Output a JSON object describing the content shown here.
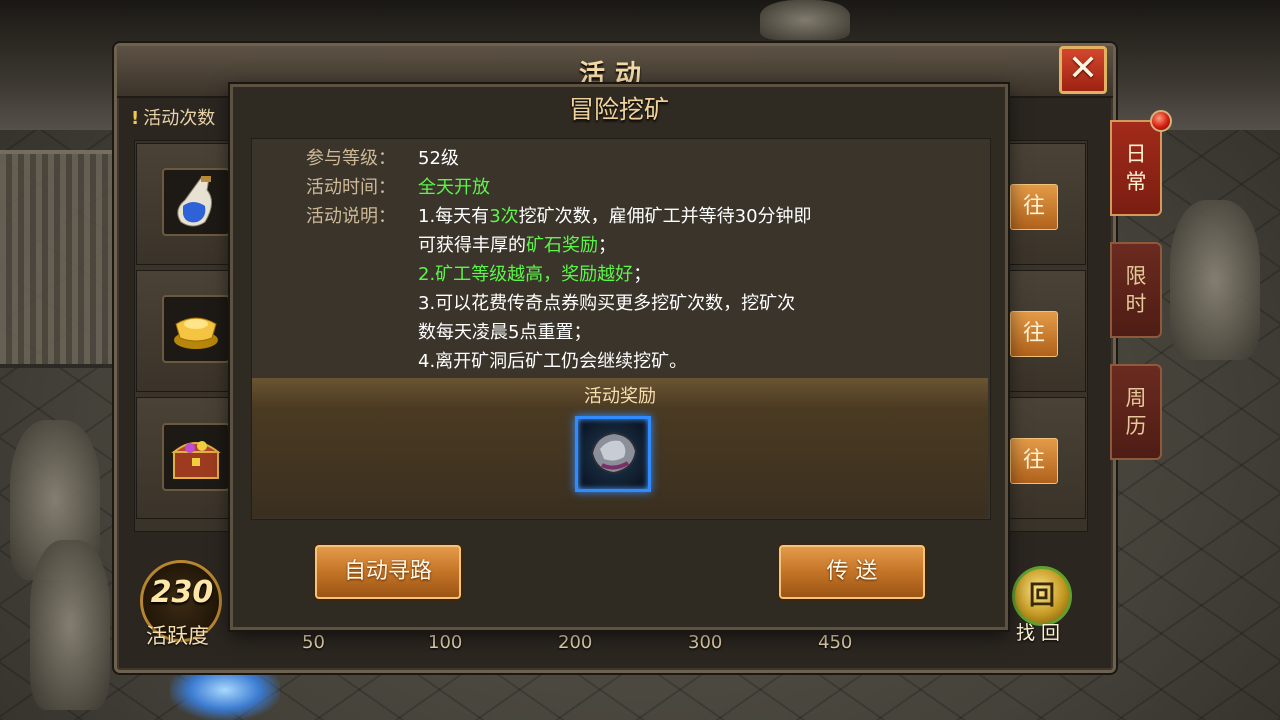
{
  "window": {
    "title": "活动",
    "close_icon": "close-icon",
    "count_label": "活动次数"
  },
  "list": {
    "rows": [
      {
        "icon": "potion-bottle-icon",
        "action_label": "往"
      },
      {
        "icon": "gold-ingot-icon",
        "action_label": "往"
      },
      {
        "icon": "treasure-chest-icon",
        "action_label": "往"
      }
    ]
  },
  "tabs": [
    {
      "label_line1": "日",
      "label_line2": "常",
      "active": true
    },
    {
      "label_line1": "限",
      "label_line2": "时",
      "active": false
    },
    {
      "label_line1": "周",
      "label_line2": "历",
      "active": false
    }
  ],
  "activity": {
    "points": "230",
    "label": "活跃度",
    "milestones": [
      "50",
      "100",
      "200",
      "300",
      "450"
    ],
    "return_icon_glyph": "回",
    "return_label": "找回"
  },
  "dialog": {
    "title": "冒险挖矿",
    "level_key": "参与等级：",
    "level_value": "52级",
    "time_key": "活动时间：",
    "time_value": "全天开放",
    "desc_key": "活动说明：",
    "desc": {
      "l1_a": "1.每天有",
      "l1_b": "3次",
      "l1_c": "挖矿次数，雇佣矿工并等待30分钟即",
      "l2_a": "可获得丰厚的",
      "l2_b": "矿石奖励",
      "l2_c": "；",
      "l3_a": "2.矿工",
      "l3_b": "等级越高，奖励越好",
      "l3_c": "；",
      "l4": "3.可以花费传奇点券购买更多挖矿次数，挖矿次",
      "l5": "数每天凌晨5点重置；",
      "l6": "4.离开矿洞后矿工仍会继续挖矿。"
    },
    "reward_title": "活动奖励",
    "reward_item_icon": "ore-stone-icon",
    "auto_path_label": "自动寻路",
    "teleport_label": "传 送"
  },
  "colors": {
    "highlight_green": "#5cf54a",
    "button_orange": "#c47427",
    "reward_frame_blue": "#2f8bff"
  }
}
